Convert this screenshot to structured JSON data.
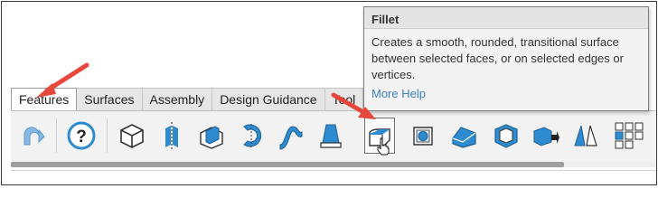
{
  "tabs": [
    {
      "label": "Features",
      "active": true
    },
    {
      "label": "Surfaces",
      "active": false
    },
    {
      "label": "Assembly",
      "active": false
    },
    {
      "label": "Design Guidance",
      "active": false
    },
    {
      "label": "Tool",
      "active": false
    }
  ],
  "toolbar": {
    "icons": [
      "redo-icon",
      "help-icon",
      "cube-icon",
      "split-icon",
      "boss-extrude-icon",
      "revolve-icon",
      "sweep-icon",
      "draft-icon",
      "fillet-icon",
      "hole-icon",
      "chamfer-icon",
      "shell-icon",
      "move-face-icon",
      "mirror-icon",
      "pattern-icon"
    ],
    "highlighted": "fillet-icon"
  },
  "tooltip": {
    "title": "Fillet",
    "description_lines": [
      "Creates a smooth, rounded, transitional surface",
      "between selected faces, or on selected edges or",
      "vertices."
    ],
    "link": "More Help"
  },
  "colors": {
    "icon_blue": "#2f8bd0",
    "arrow_red": "#e8483b",
    "link_blue": "#3b7fc4"
  }
}
